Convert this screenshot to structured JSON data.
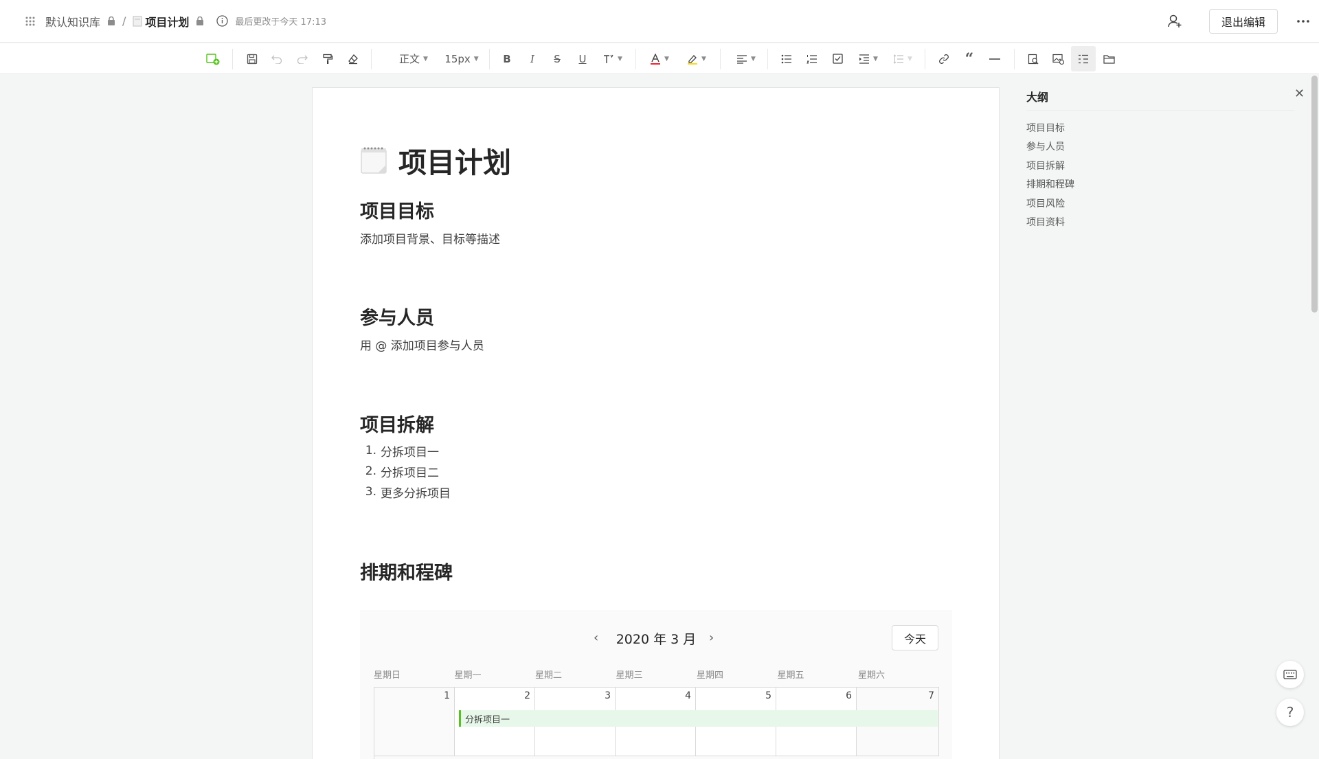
{
  "header": {
    "library": "默认知识库",
    "separator": "/",
    "doc_title": "项目计划",
    "last_modified": "最后更改于今天 17:13",
    "exit_edit": "退出编辑"
  },
  "toolbar": {
    "paragraph_style": "正文",
    "font_size": "15px"
  },
  "document": {
    "title": "项目计划",
    "sections": {
      "goal": {
        "heading": "项目目标",
        "text": "添加项目背景、目标等描述"
      },
      "members": {
        "heading": "参与人员",
        "text": "用 @ 添加项目参与人员"
      },
      "breakdown": {
        "heading": "项目拆解",
        "items": [
          {
            "num": "1.",
            "text": "分拆项目一"
          },
          {
            "num": "2.",
            "text": "分拆项目二"
          },
          {
            "num": "3.",
            "text": "更多分拆项目"
          }
        ]
      },
      "schedule": {
        "heading": "排期和程碑"
      }
    }
  },
  "calendar": {
    "title": "2020 年 3 月",
    "today": "今天",
    "weekdays": [
      "星期日",
      "星期一",
      "星期二",
      "星期三",
      "星期四",
      "星期五",
      "星期六"
    ],
    "days": [
      "1",
      "2",
      "3",
      "4",
      "5",
      "6",
      "7"
    ],
    "event": "分拆项目一"
  },
  "outline": {
    "title": "大纲",
    "items": [
      "项目目标",
      "参与人员",
      "项目拆解",
      "排期和程碑",
      "项目风险",
      "项目资料"
    ]
  },
  "colors": {
    "accent_green": "#52c41a",
    "event_bg": "#e7f7e9",
    "font_color_underline": "#f5222d",
    "highlight_underline": "#fadb14"
  }
}
